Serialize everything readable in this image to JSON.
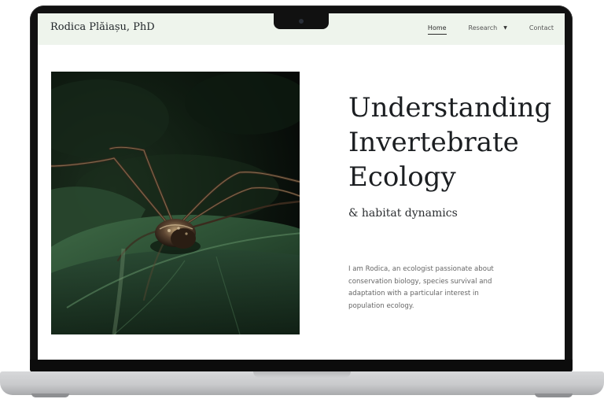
{
  "site": {
    "brand": "Rodica Plăiașu, PhD",
    "nav": [
      {
        "label": "Home",
        "active": true
      },
      {
        "label": "Research",
        "has_dropdown": true
      },
      {
        "label": "Contact"
      }
    ]
  },
  "hero": {
    "title_lines": [
      "Understanding",
      "Invertebrate",
      "Ecology"
    ],
    "subtitle": "& habitat dynamics",
    "intro_lines": [
      "I am Rodica, an ecologist passionate about",
      "conservation biology, species survival and",
      "adaptation with a particular interest in",
      "population ecology."
    ]
  },
  "icons": {
    "dropdown": "caret-down-icon",
    "camera": "webcam-dot"
  },
  "colors": {
    "header_bg": "#eef4ec",
    "title_text": "#1b1e21",
    "body_text": "#666666",
    "laptop_bezel": "#111111",
    "laptop_base": "#c9cacc"
  }
}
